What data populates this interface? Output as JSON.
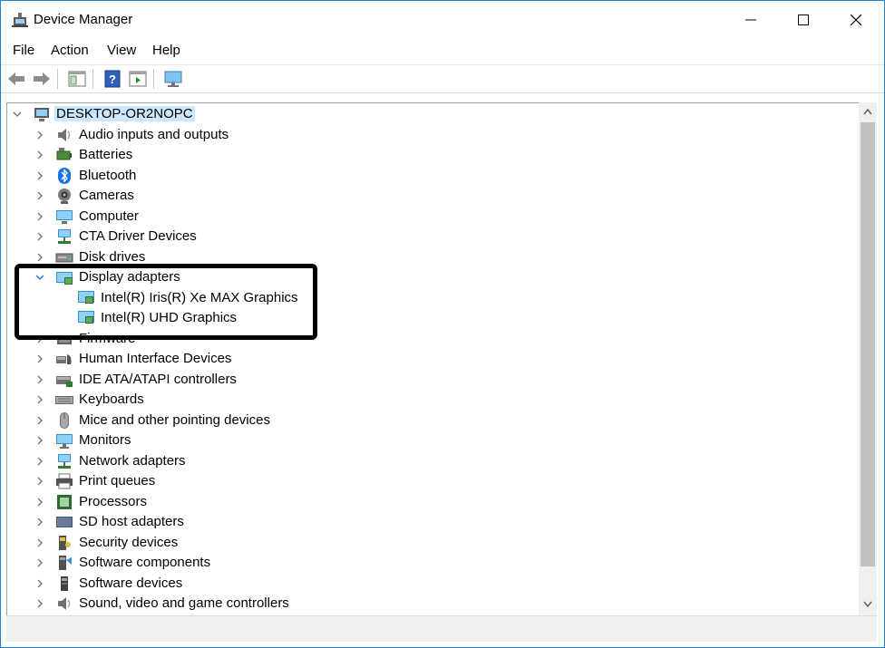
{
  "window": {
    "title": "Device Manager"
  },
  "menu": [
    "File",
    "Action",
    "View",
    "Help"
  ],
  "toolbar": {
    "buttons": [
      "back-icon",
      "forward-icon",
      "properties-pane-icon",
      "help-icon",
      "run-icon",
      "scan-monitor-icon"
    ]
  },
  "tree": {
    "root": "DESKTOP-OR2NOPC",
    "categories": [
      {
        "label": "Audio inputs and outputs",
        "icon": "speaker-icon"
      },
      {
        "label": "Batteries",
        "icon": "battery-icon"
      },
      {
        "label": "Bluetooth",
        "icon": "bluetooth-icon"
      },
      {
        "label": "Cameras",
        "icon": "camera-icon"
      },
      {
        "label": "Computer",
        "icon": "computer-icon"
      },
      {
        "label": "CTA Driver Devices",
        "icon": "network-icon"
      },
      {
        "label": "Disk drives",
        "icon": "disk-icon"
      },
      {
        "label": "Display adapters",
        "icon": "display-adapter-icon",
        "expanded": true,
        "children": [
          "Intel(R) Iris(R) Xe MAX Graphics",
          "Intel(R) UHD Graphics"
        ]
      },
      {
        "label": "Firmware",
        "icon": "firmware-icon"
      },
      {
        "label": "Human Interface Devices",
        "icon": "hid-icon"
      },
      {
        "label": "IDE ATA/ATAPI controllers",
        "icon": "ide-icon"
      },
      {
        "label": "Keyboards",
        "icon": "keyboard-icon"
      },
      {
        "label": "Mice and other pointing devices",
        "icon": "mouse-icon"
      },
      {
        "label": "Monitors",
        "icon": "monitor-icon"
      },
      {
        "label": "Network adapters",
        "icon": "network-icon"
      },
      {
        "label": "Print queues",
        "icon": "printer-icon"
      },
      {
        "label": "Processors",
        "icon": "processor-icon"
      },
      {
        "label": "SD host adapters",
        "icon": "sd-icon"
      },
      {
        "label": "Security devices",
        "icon": "security-icon"
      },
      {
        "label": "Software components",
        "icon": "software-component-icon"
      },
      {
        "label": "Software devices",
        "icon": "software-device-icon"
      },
      {
        "label": "Sound, video and game controllers",
        "icon": "speaker-icon"
      }
    ]
  },
  "colors": {
    "border": "#1883d7",
    "root_highlight": "#cce8ff",
    "annotation": "#000000"
  }
}
